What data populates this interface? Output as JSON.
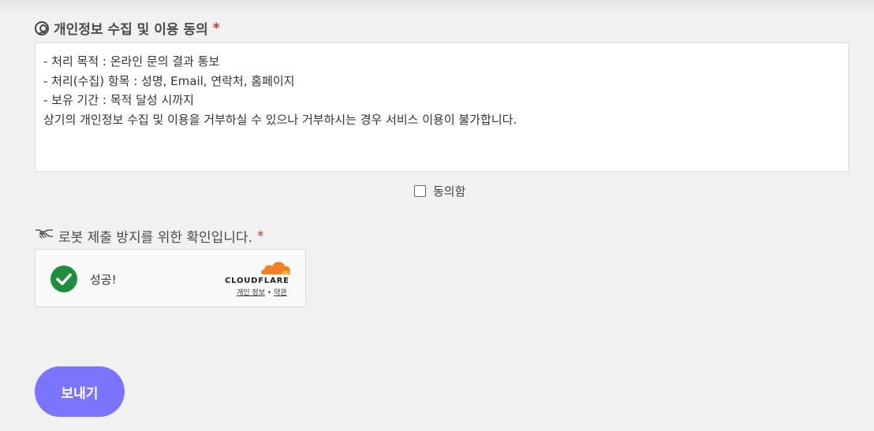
{
  "privacy": {
    "title": "개인정보 수집 및 이용 동의",
    "required_mark": "*",
    "text": "- 처리 목적 : 온라인 문의 결과 통보\n- 처리(수집) 항목 : 성명, Email, 연락처, 홈페이지\n- 보유 기간 : 목적 달성 시까지\n상기의 개인정보 수집 및 이용을 거부하실 수 있으나 거부하시는 경우 서비스 이용이 불가합니다.",
    "agree_label": "동의함",
    "icon": "user-circle-icon"
  },
  "robot": {
    "title": "로봇 제출 방지를 위한 확인입니다.",
    "required_mark": "*",
    "icon": "handshake-icon"
  },
  "turnstile": {
    "status": "성공!",
    "brand": "CLOUDFLARE",
    "privacy_link": "개인 정보",
    "separator": "•",
    "terms_link": "약관",
    "brand_color": "#f38020",
    "success_color": "#1e8e3e"
  },
  "submit": {
    "label": "보내기",
    "color": "#7a74ff"
  }
}
